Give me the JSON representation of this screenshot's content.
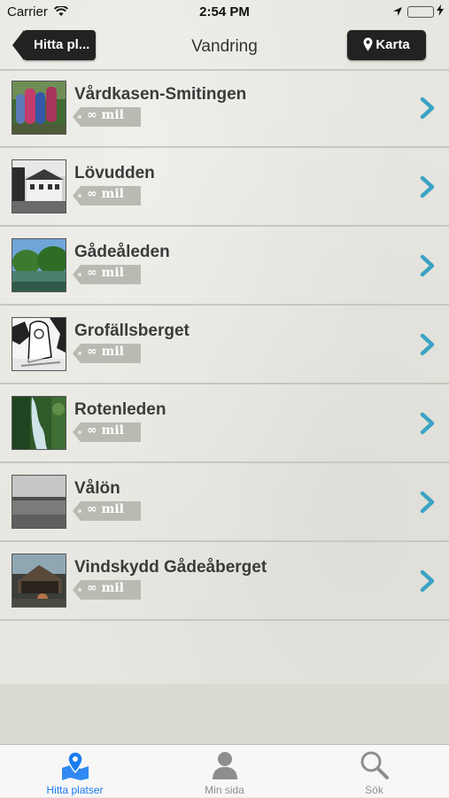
{
  "status_bar": {
    "carrier": "Carrier",
    "time": "2:54 PM"
  },
  "nav": {
    "back_label": "Hitta pl...",
    "title": "Vandring",
    "map_label": "Karta"
  },
  "list": [
    {
      "title": "Vårdkasen-Smitingen",
      "distance": "∞ mil"
    },
    {
      "title": "Lövudden",
      "distance": "∞ mil"
    },
    {
      "title": "Gådeåleden",
      "distance": "∞ mil"
    },
    {
      "title": "Grofällsberget",
      "distance": "∞ mil"
    },
    {
      "title": "Rotenleden",
      "distance": "∞ mil"
    },
    {
      "title": "Vålön",
      "distance": "∞ mil"
    },
    {
      "title": "Vindskydd Gådeåberget",
      "distance": "∞ mil"
    }
  ],
  "tabs": [
    {
      "label": "Hitta platser",
      "icon": "map-pin-icon",
      "active": true
    },
    {
      "label": "Min sida",
      "icon": "person-icon",
      "active": false
    },
    {
      "label": "Sök",
      "icon": "search-icon",
      "active": false
    }
  ],
  "colors": {
    "accent": "#1a7cf0",
    "chevron": "#3aa3c5",
    "button_dark": "#222222",
    "tag": "#b9b8b0"
  }
}
